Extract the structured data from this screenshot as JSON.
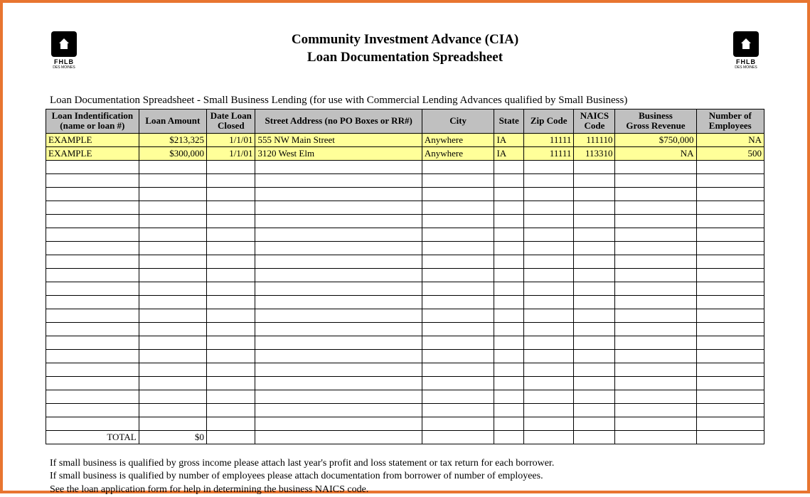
{
  "header": {
    "logo_text": "FHLB",
    "logo_sub": "DES MOINES",
    "title_line1": "Community Investment Advance (CIA)",
    "title_line2": "Loan Documentation Spreadsheet"
  },
  "subtitle": "Loan Documentation Spreadsheet - Small Business Lending (for use with Commercial Lending Advances qualified by Small Business)",
  "columns": {
    "loan_id": "Loan Indentification (name or loan #)",
    "amount": "Loan Amount",
    "date": "Date Loan Closed",
    "street": "Street Address (no PO Boxes or RR#)",
    "city": "City",
    "state": "State",
    "zip": "Zip Code",
    "naics": "NAICS Code",
    "revenue": "Business Gross Revenue",
    "employees": "Number of Employees"
  },
  "rows": [
    {
      "loan_id": "EXAMPLE",
      "amount": "$213,325",
      "date": "1/1/01",
      "street": "555 NW Main Street",
      "city": "Anywhere",
      "state": "IA",
      "zip": "11111",
      "naics": "111110",
      "revenue": "$750,000",
      "employees": "NA"
    },
    {
      "loan_id": "EXAMPLE",
      "amount": "$300,000",
      "date": "1/1/01",
      "street": "3120 West Elm",
      "city": "Anywhere",
      "state": "IA",
      "zip": "11111",
      "naics": "113310",
      "revenue": "NA",
      "employees": "500"
    }
  ],
  "empty_row_count": 20,
  "total": {
    "label": "TOTAL",
    "amount": "$0"
  },
  "footer": {
    "line1": "If small business is qualified by gross income please attach last year's profit and loss statement or tax return for each borrower.",
    "line2": "If small business is qualified by number of employees please attach documentation from borrower of number of employees.",
    "line3": "See the loan application form for help in determining the business NAICS code."
  }
}
